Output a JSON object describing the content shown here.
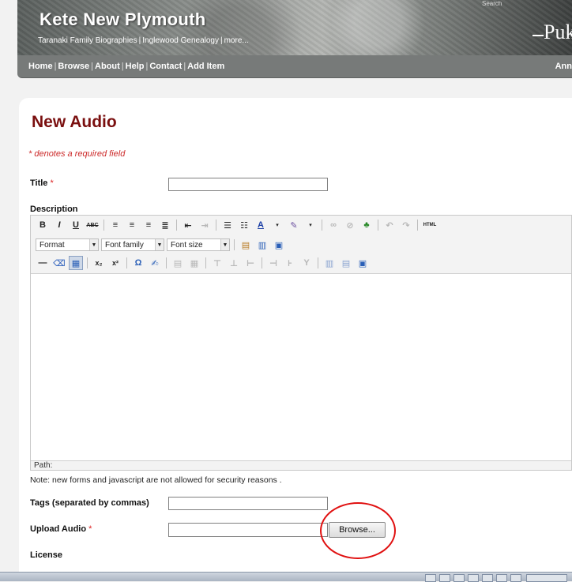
{
  "header": {
    "site_title": "Kete New Plymouth",
    "baskets": [
      "Taranaki Family Biographies",
      "Inglewood Genealogy",
      "more..."
    ],
    "search_stub": "Search",
    "logo_text": "Puk"
  },
  "nav": {
    "links": [
      "Home",
      "Browse",
      "About",
      "Help",
      "Contact",
      "Add Item"
    ],
    "right_text": "Ann"
  },
  "form": {
    "page_title": "New Audio",
    "required_note": "* denotes a required field",
    "title_label": "Title",
    "required_star": "*",
    "description_label": "Description",
    "toolbar": {
      "format_label": "Format",
      "font_family_label": "Font family",
      "font_size_label": "Font size"
    },
    "path_label": "Path:",
    "security_note": "Note: new forms and javascript are not allowed for security reasons .",
    "tags_label": "Tags (separated by commas)",
    "upload_label": "Upload Audio",
    "browse_label": "Browse...",
    "license_label": "License"
  },
  "colors": {
    "title_red": "#7a0f0f",
    "required_red": "#cc2a2a",
    "nav_gray": "#777a79",
    "annotation_circle": "#e01010"
  }
}
